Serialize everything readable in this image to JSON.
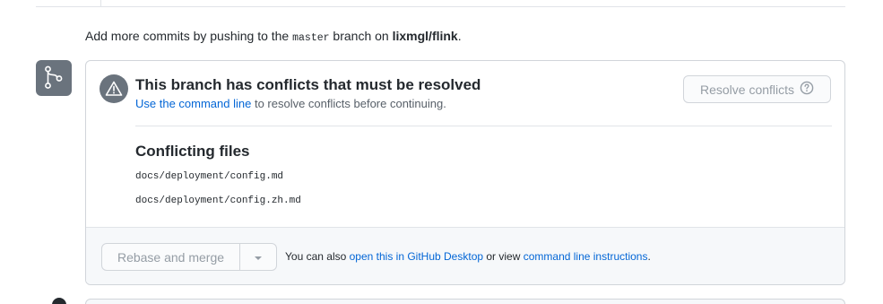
{
  "hint": {
    "prefix": "Add more commits by pushing to the ",
    "branch": "master",
    "middle": " branch on ",
    "repo": "lixmgl/flink",
    "suffix": "."
  },
  "merge_icon": "git-branch-icon",
  "status": {
    "icon": "alert-icon",
    "title": "This branch has conflicts that must be resolved",
    "link_text": "Use the command line",
    "desc_rest": " to resolve conflicts before continuing."
  },
  "resolve_button": {
    "label": "Resolve conflicts",
    "icon": "question-icon"
  },
  "conflicts": {
    "title": "Conflicting files",
    "files": [
      "docs/deployment/config.md",
      "docs/deployment/config.zh.md"
    ]
  },
  "merge": {
    "button_label": "Rebase and merge",
    "dropdown_icon": "caret-down-icon",
    "help_prefix": "You can also ",
    "help_link1": "open this in GitHub Desktop",
    "help_middle": " or view ",
    "help_link2": "command line instructions",
    "help_suffix": "."
  },
  "colors": {
    "link": "#0366d6",
    "icon_bg": "#6a737d",
    "disabled_text": "#959da5"
  }
}
